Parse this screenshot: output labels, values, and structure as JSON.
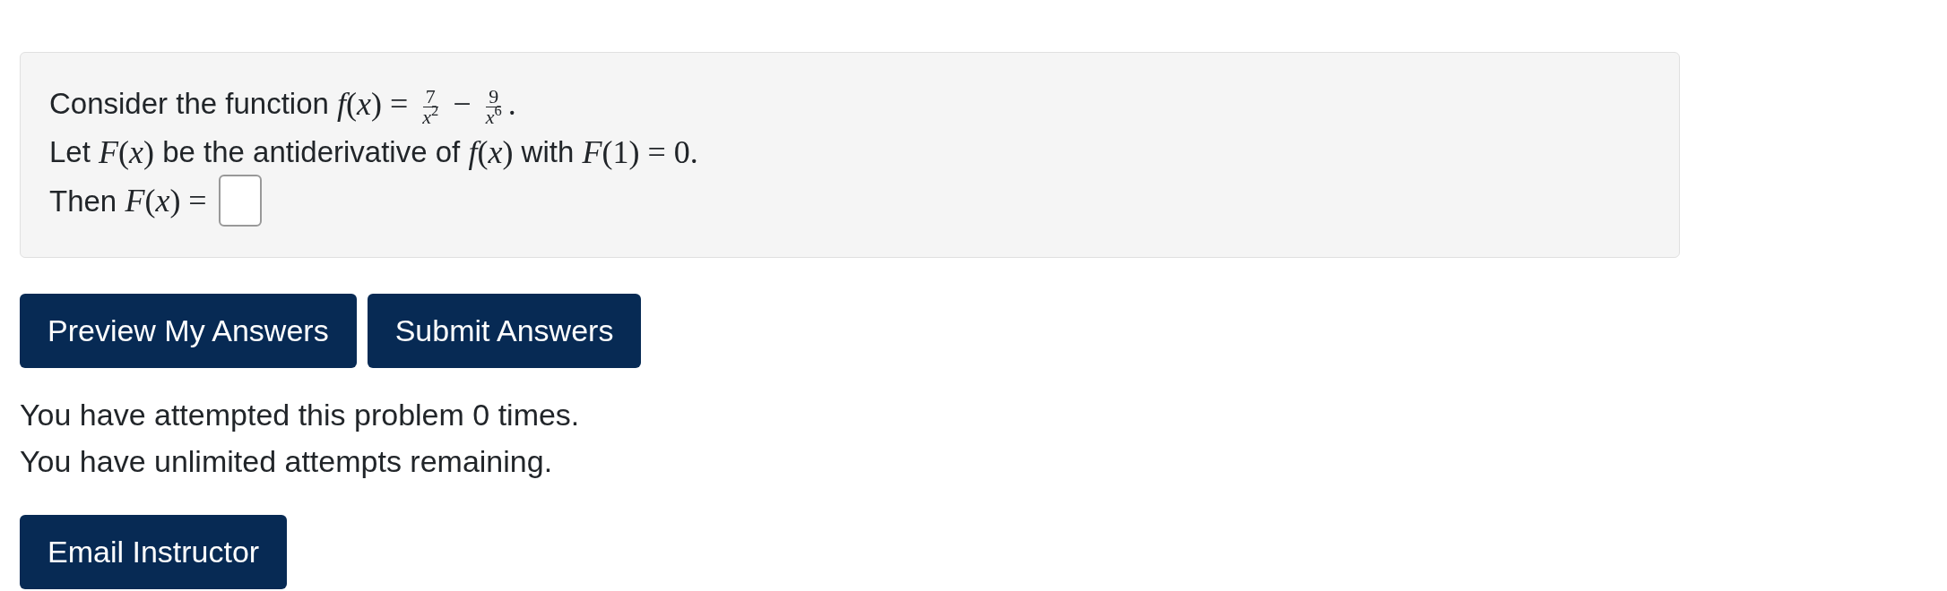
{
  "problem": {
    "lines": [
      [
        {
          "kind": "text",
          "text": "Consider the function "
        },
        {
          "kind": "math",
          "text": "*f*(*x*) = "
        },
        {
          "kind": "frac",
          "num": "7",
          "den": "*x*$^{2}$"
        },
        {
          "kind": "math",
          "text": " − "
        },
        {
          "kind": "frac",
          "num": "9",
          "den": "*x*$^{6}$"
        },
        {
          "kind": "math",
          "text": "."
        }
      ],
      [
        {
          "kind": "text",
          "text": "Let "
        },
        {
          "kind": "math",
          "text": "*F*(*x*)"
        },
        {
          "kind": "text",
          "text": " be the antiderivative of "
        },
        {
          "kind": "math",
          "text": "*f*(*x*)"
        },
        {
          "kind": "text",
          "text": " with "
        },
        {
          "kind": "math",
          "text": "*F*(1) = 0."
        }
      ],
      [
        {
          "kind": "text",
          "text": "Then "
        },
        {
          "kind": "math",
          "text": "*F*(*x*) = "
        },
        {
          "kind": "answer_field"
        }
      ]
    ]
  },
  "buttons": [
    "Preview My Answers",
    "Submit Answers"
  ],
  "attempts": [
    "You have attempted this problem 0 times.",
    "You have unlimited attempts remaining."
  ],
  "email_button": "Email Instructor"
}
